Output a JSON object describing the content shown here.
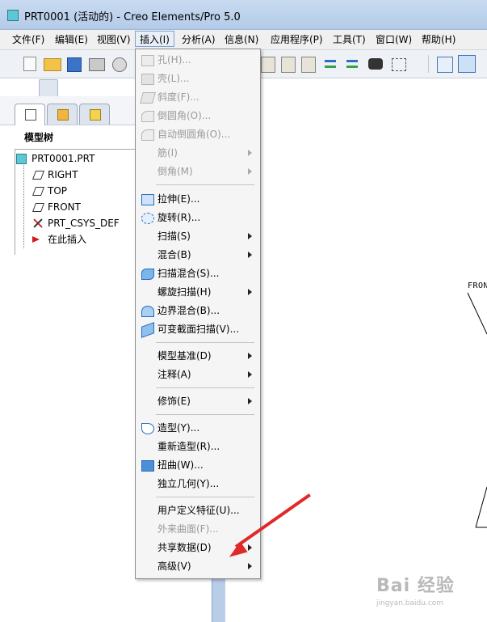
{
  "window": {
    "title": "PRT0001 (活动的) - Creo Elements/Pro 5.0"
  },
  "menubar": {
    "items": [
      {
        "label": "文件(F)"
      },
      {
        "label": "编辑(E)"
      },
      {
        "label": "视图(V)"
      },
      {
        "label": "插入(I)",
        "active": true
      },
      {
        "label": "分析(A)"
      },
      {
        "label": "信息(N)"
      },
      {
        "label": "应用程序(P)"
      },
      {
        "label": "工具(T)"
      },
      {
        "label": "窗口(W)"
      },
      {
        "label": "帮助(H)"
      }
    ]
  },
  "insert_menu": {
    "items": [
      {
        "label": "孔(H)...",
        "disabled": true,
        "icon": "hole-icon"
      },
      {
        "label": "壳(L)...",
        "disabled": true,
        "icon": "shell-icon"
      },
      {
        "label": "斜度(F)...",
        "disabled": true,
        "icon": "draft-icon"
      },
      {
        "label": "倒圆角(O)...",
        "disabled": true,
        "icon": "round-icon"
      },
      {
        "label": "自动倒圆角(O)...",
        "disabled": true,
        "icon": "auto-round-icon"
      },
      {
        "label": "筋(I)",
        "disabled": true,
        "submenu": true
      },
      {
        "label": "倒角(M)",
        "disabled": true,
        "submenu": true
      },
      {
        "label": "拉伸(E)...",
        "icon": "extrude-icon"
      },
      {
        "label": "旋转(R)...",
        "icon": "revolve-icon"
      },
      {
        "label": "扫描(S)",
        "submenu": true
      },
      {
        "label": "混合(B)",
        "submenu": true
      },
      {
        "label": "扫描混合(S)...",
        "icon": "swept-blend-icon"
      },
      {
        "label": "螺旋扫描(H)",
        "submenu": true
      },
      {
        "label": "边界混合(B)...",
        "icon": "boundary-blend-icon"
      },
      {
        "label": "可变截面扫描(V)...",
        "icon": "variable-section-sweep-icon"
      },
      {
        "label": "模型基准(D)",
        "submenu": true
      },
      {
        "label": "注释(A)",
        "submenu": true
      },
      {
        "label": "修饰(E)",
        "submenu": true
      },
      {
        "label": "造型(Y)...",
        "icon": "style-icon"
      },
      {
        "label": "重新造型(R)..."
      },
      {
        "label": "扭曲(W)...",
        "icon": "warp-icon"
      },
      {
        "label": "独立几何(Y)..."
      },
      {
        "label": "用户定义特征(U)..."
      },
      {
        "label": "外来曲面(F)...",
        "disabled": true
      },
      {
        "label": "共享数据(D)",
        "submenu": true
      },
      {
        "label": "高级(V)",
        "submenu": true
      }
    ]
  },
  "model_tree": {
    "title": "模型树",
    "items": [
      {
        "label": "PRT0001.PRT",
        "icon": "part-icon"
      },
      {
        "label": "RIGHT",
        "icon": "datum-plane-icon"
      },
      {
        "label": "TOP",
        "icon": "datum-plane-icon"
      },
      {
        "label": "FRONT",
        "icon": "datum-plane-icon"
      },
      {
        "label": "PRT_CSYS_DEF",
        "icon": "csys-icon"
      },
      {
        "label": "在此插入",
        "icon": "insert-here-arrow-icon"
      }
    ]
  },
  "graphics": {
    "datum_label": "FRON"
  },
  "colors": {
    "accent_red_arrow": "#e02a2a",
    "splitter": "#b8cde8",
    "part_icon": "#5cc7d6"
  },
  "watermark": {
    "logo": "Bai 经验",
    "sub": "jingyan.baidu.com"
  }
}
